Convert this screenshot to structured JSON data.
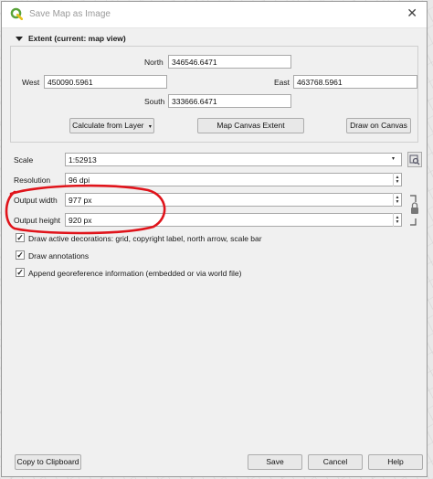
{
  "window": {
    "title": "Save Map as Image",
    "close_glyph": "✕"
  },
  "extent": {
    "header": "Extent (current: map view)",
    "north_label": "North",
    "north_value": "346546.6471",
    "west_label": "West",
    "west_value": "450090.5961",
    "east_label": "East",
    "east_value": "463768.5961",
    "south_label": "South",
    "south_value": "333666.6471",
    "calc_layer_btn": "Calculate from Layer",
    "canvas_extent_btn": "Map Canvas Extent",
    "draw_canvas_btn": "Draw on Canvas"
  },
  "settings": {
    "scale_label": "Scale",
    "scale_value": "1:52913",
    "resolution_label": "Resolution",
    "resolution_value": "96 dpi",
    "width_label": "Output width",
    "width_value": "977 px",
    "height_label": "Output height",
    "height_value": "920 px"
  },
  "options": [
    {
      "label": "Draw active decorations: grid, copyright label, north arrow, scale bar",
      "checked": true
    },
    {
      "label": "Draw annotations",
      "checked": true
    },
    {
      "label": "Append georeference information (embedded or via world file)",
      "checked": true
    }
  ],
  "footer": {
    "copy_btn": "Copy to Clipboard",
    "save_btn": "Save",
    "cancel_btn": "Cancel",
    "help_btn": "Help"
  },
  "annotation_color": "#e0141b"
}
